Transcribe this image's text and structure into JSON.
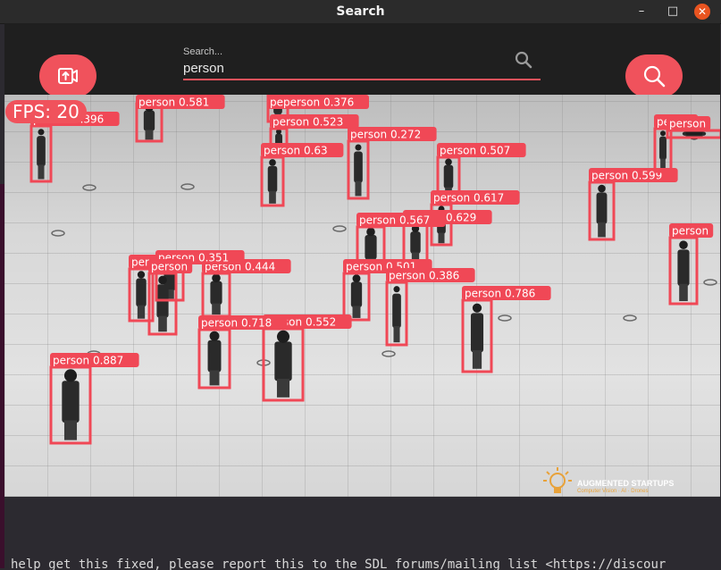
{
  "window": {
    "title": "Search",
    "minimize_glyph": "–",
    "maximize_glyph": "□",
    "close_glyph": "✕"
  },
  "search": {
    "label": "Search...",
    "value": "person"
  },
  "icons": {
    "upload_button": "upload-icon",
    "search_button": "search-icon",
    "search_field_icon": "magnifier-icon"
  },
  "overlay": {
    "fps_text": "FPS: 20"
  },
  "watermark": {
    "line1": "AUGMENTED STARTUPS",
    "line2": "Computer Vision · AI · Drones"
  },
  "terminal": {
    "text": "help get this fixed, please report this to the SDL forums/mailing list <https://discour"
  },
  "colors": {
    "accent": "#f0525c",
    "box": "#f04856",
    "titlebar": "#2b2b2b",
    "close": "#e95420"
  },
  "detections": [
    {
      "label": "person  0.396"
    },
    {
      "label": "person  0.581"
    },
    {
      "label": "peperson  0.376"
    },
    {
      "label": "person  0.523"
    },
    {
      "label": "person  0.272"
    },
    {
      "label": "person  0.63"
    },
    {
      "label": "person  0.507"
    },
    {
      "label": "person  0.617"
    },
    {
      "label": "person  0.629"
    },
    {
      "label": "person  0.567"
    },
    {
      "label": "person  0.599"
    },
    {
      "label": "person"
    },
    {
      "label": "person"
    },
    {
      "label": "person"
    },
    {
      "label": "person  0.444"
    },
    {
      "label": "person  0.351"
    },
    {
      "label": "person"
    },
    {
      "label": "person  0.501"
    },
    {
      "label": "person  0.386"
    },
    {
      "label": "person  0.786"
    },
    {
      "label": "person  0.552"
    },
    {
      "label": "person  0.718"
    },
    {
      "label": "person  0.887"
    },
    {
      "label": "person"
    }
  ]
}
